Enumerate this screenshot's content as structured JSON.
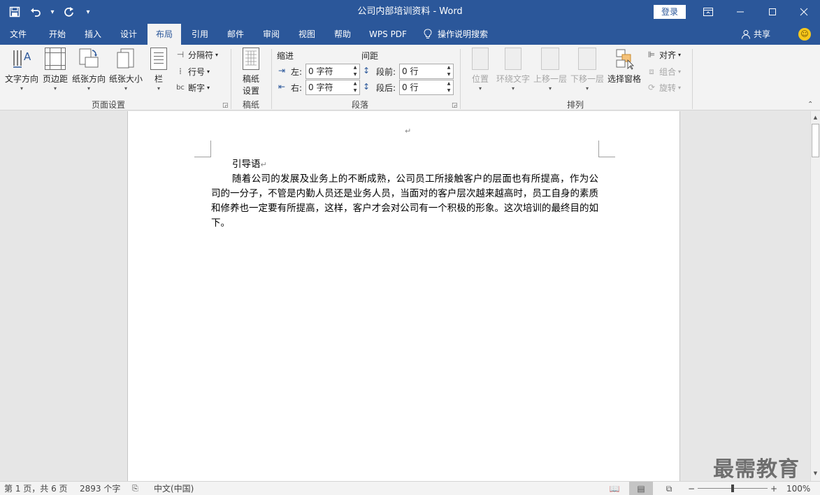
{
  "window": {
    "title": "公司内部培训资料 - Word",
    "login_label": "登录",
    "controls": [
      "restore-ribbon",
      "minimize",
      "maximize",
      "close"
    ]
  },
  "quick_access": {
    "save_icon": "save-icon",
    "undo_icon": "undo-icon",
    "redo_icon": "redo-icon",
    "customize_icon": "customize-qat-icon"
  },
  "tabs": [
    {
      "label": "文件"
    },
    {
      "label": "开始"
    },
    {
      "label": "插入"
    },
    {
      "label": "设计"
    },
    {
      "label": "布局",
      "active": true
    },
    {
      "label": "引用"
    },
    {
      "label": "邮件"
    },
    {
      "label": "审阅"
    },
    {
      "label": "视图"
    },
    {
      "label": "帮助"
    },
    {
      "label": "WPS PDF"
    },
    {
      "label": "操作说明搜索"
    }
  ],
  "share_label": "共享",
  "ribbon": {
    "page_setup": {
      "group_label": "页面设置",
      "text_direction": "文字方向",
      "margins": "页边距",
      "orientation": "纸张方向",
      "size": "纸张大小",
      "columns": "栏",
      "breaks": "分隔符",
      "line_numbers": "行号",
      "hyphenation": "断字"
    },
    "manuscript": {
      "group_label": "稿纸",
      "setup_line1": "稿纸",
      "setup_line2": "设置"
    },
    "paragraph": {
      "group_label": "段落",
      "indent_heading": "缩进",
      "spacing_heading": "间距",
      "left_label": "左:",
      "right_label": "右:",
      "before_label": "段前:",
      "after_label": "段后:",
      "left_value": "0 字符",
      "right_value": "0 字符",
      "before_value": "0 行",
      "after_value": "0 行"
    },
    "arrange": {
      "group_label": "排列",
      "position": "位置",
      "wrap_text": "环绕文字",
      "bring_forward": "上移一层",
      "send_backward": "下移一层",
      "selection_pane": "选择窗格",
      "align": "对齐",
      "group": "组合",
      "rotate": "旋转"
    }
  },
  "document": {
    "heading": "引导语",
    "body": "随着公司的发展及业务上的不断成熟，公司员工所接触客户的层面也有所提高，作为公司的一分子，不管是内勤人员还是业务人员，当面对的客户层次越来越高时，员工自身的素质和修养也一定要有所提高，这样，客户才会对公司有一个积极的形象。这次培训的最终目的如下。"
  },
  "watermark": "最需教育",
  "status": {
    "page_info": "第 1 页，共 6 页",
    "word_count": "2893 个字",
    "language": "中文(中国)",
    "zoom": "100%"
  }
}
